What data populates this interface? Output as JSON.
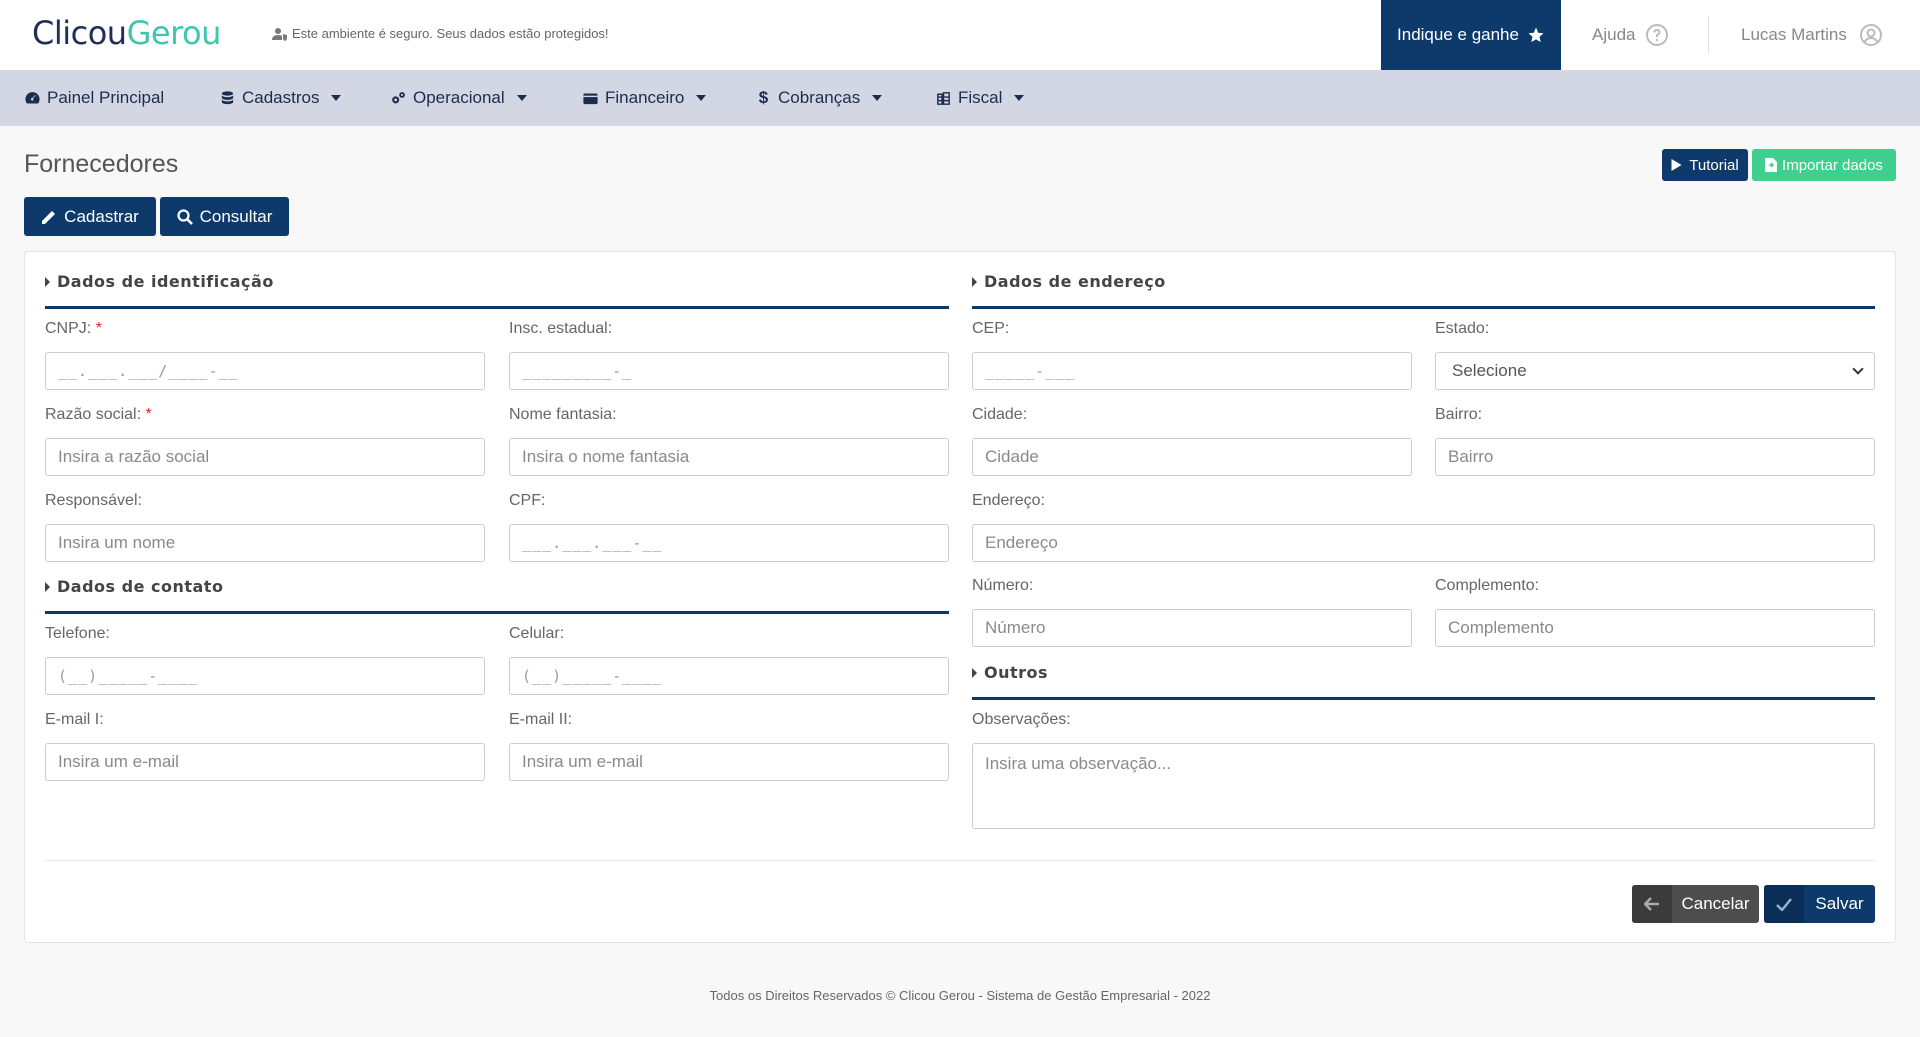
{
  "header": {
    "logo_part1": "Clicou",
    "logo_part2": "Gerou",
    "secure_text": "Este ambiente é seguro. Seus dados estão protegidos!",
    "indique_label": "Indique e ganhe",
    "ajuda_label": "Ajuda",
    "user_name": "Lucas Martins"
  },
  "nav": {
    "items": [
      {
        "label": "Painel Principal",
        "icon": "dashboard-icon"
      },
      {
        "label": "Cadastros",
        "icon": "database-icon"
      },
      {
        "label": "Operacional",
        "icon": "cogs-icon"
      },
      {
        "label": "Financeiro",
        "icon": "wallet-icon"
      },
      {
        "label": "Cobranças",
        "icon": "dollar-icon"
      },
      {
        "label": "Fiscal",
        "icon": "building-icon"
      }
    ]
  },
  "page": {
    "title": "Fornecedores",
    "tutorial_label": "Tutorial",
    "import_label": "Importar dados",
    "cadastrar_label": "Cadastrar",
    "consultar_label": "Consultar"
  },
  "form": {
    "sections": {
      "identificacao": "Dados de identificação",
      "endereco": "Dados de endereço",
      "contato": "Dados de contato",
      "outros": "Outros"
    },
    "fields": {
      "cnpj": {
        "label": "CNPJ:",
        "placeholder": "__.___.___/____-__"
      },
      "insc_estadual": {
        "label": "Insc. estadual:",
        "placeholder": "_________-_"
      },
      "razao_social": {
        "label": "Razão social:",
        "placeholder": "Insira a razão social"
      },
      "nome_fantasia": {
        "label": "Nome fantasia:",
        "placeholder": "Insira o nome fantasia"
      },
      "responsavel": {
        "label": "Responsável:",
        "placeholder": "Insira um nome"
      },
      "cpf": {
        "label": "CPF:",
        "placeholder": "___.___.___-__"
      },
      "telefone": {
        "label": "Telefone:",
        "placeholder": "(__)_____-____"
      },
      "celular": {
        "label": "Celular:",
        "placeholder": "(__)_____-____"
      },
      "email1": {
        "label": "E-mail I:",
        "placeholder": "Insira um e-mail"
      },
      "email2": {
        "label": "E-mail II:",
        "placeholder": "Insira um e-mail"
      },
      "cep": {
        "label": "CEP:",
        "placeholder": "_____-___"
      },
      "estado": {
        "label": "Estado:",
        "value": "Selecione"
      },
      "cidade": {
        "label": "Cidade:",
        "placeholder": "Cidade"
      },
      "bairro": {
        "label": "Bairro:",
        "placeholder": "Bairro"
      },
      "endereco": {
        "label": "Endereço:",
        "placeholder": "Endereço"
      },
      "numero": {
        "label": "Número:",
        "placeholder": "Número"
      },
      "complemento": {
        "label": "Complemento:",
        "placeholder": "Complemento"
      },
      "observacoes": {
        "label": "Observações:",
        "placeholder": "Insira uma observação..."
      }
    },
    "required_mark": "*",
    "cancel_label": "Cancelar",
    "save_label": "Salvar"
  },
  "footer": {
    "text": "Todos os Direitos Reservados © Clicou Gerou - Sistema de Gestão Empresarial - 2022"
  },
  "colors": {
    "primary": "#0e3a6b",
    "accent_green": "#3fcf8e",
    "nav_bg": "#d3d7e4",
    "logo_teal": "#3ec6b0"
  }
}
